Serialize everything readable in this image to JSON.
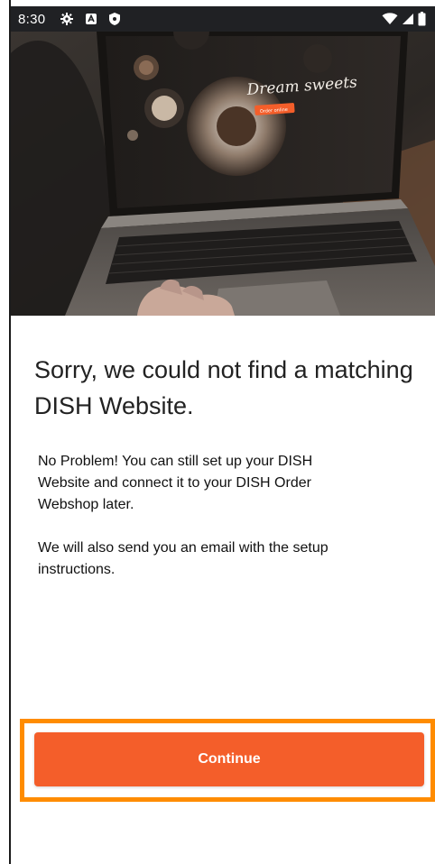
{
  "status_bar": {
    "time": "8:30",
    "left_icons": [
      "gear-icon",
      "a-badge-icon",
      "shield-icon"
    ],
    "right_icons": [
      "wifi-icon",
      "signal-icon",
      "battery-icon"
    ]
  },
  "hero": {
    "screen_script_text": "Dream sweets",
    "screen_button_text": "Order online"
  },
  "content": {
    "title": "Sorry, we could not find a matching DISH Website.",
    "message": "No Problem! You can still set up your DISH\n Website and connect it to your DISH Order\nWebshop later.",
    "message2": " We will also send you an email with the setup\ninstructions."
  },
  "actions": {
    "continue_label": "Continue"
  },
  "colors": {
    "accent": "#f45e2a",
    "highlight": "#ff8c00",
    "status_bar_bg": "#202124"
  }
}
